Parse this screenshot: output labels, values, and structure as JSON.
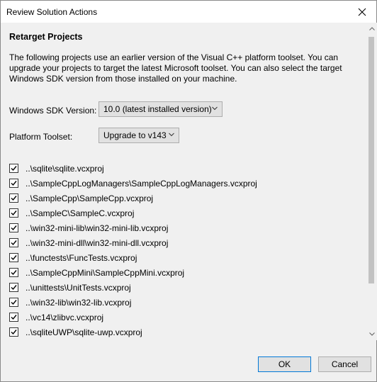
{
  "window": {
    "title": "Review Solution Actions"
  },
  "section": {
    "heading": "Retarget Projects",
    "description": "The following projects use an earlier version of the Visual C++ platform toolset.  You can upgrade your projects to target the latest Microsoft toolset.  You can also select the target Windows SDK version from those installed on your machine."
  },
  "sdk": {
    "label": "Windows SDK Version:",
    "value": "10.0 (latest installed version)"
  },
  "toolset": {
    "label": "Platform Toolset:",
    "value": "Upgrade to v143"
  },
  "projects": [
    {
      "label": "..\\sqlite\\sqlite.vcxproj",
      "checked": true
    },
    {
      "label": "..\\SampleCppLogManagers\\SampleCppLogManagers.vcxproj",
      "checked": true
    },
    {
      "label": "..\\SampleCpp\\SampleCpp.vcxproj",
      "checked": true
    },
    {
      "label": "..\\SampleC\\SampleC.vcxproj",
      "checked": true
    },
    {
      "label": "..\\win32-mini-lib\\win32-mini-lib.vcxproj",
      "checked": true
    },
    {
      "label": "..\\win32-mini-dll\\win32-mini-dll.vcxproj",
      "checked": true
    },
    {
      "label": "..\\functests\\FuncTests.vcxproj",
      "checked": true
    },
    {
      "label": "..\\SampleCppMini\\SampleCppMini.vcxproj",
      "checked": true
    },
    {
      "label": "..\\unittests\\UnitTests.vcxproj",
      "checked": true
    },
    {
      "label": "..\\win32-lib\\win32-lib.vcxproj",
      "checked": true
    },
    {
      "label": "..\\vc14\\zlibvc.vcxproj",
      "checked": true
    },
    {
      "label": "..\\sqliteUWP\\sqlite-uwp.vcxproj",
      "checked": true
    }
  ],
  "buttons": {
    "ok": "OK",
    "cancel": "Cancel"
  },
  "icons": {
    "close": "close-icon",
    "check": "checkmark-icon",
    "dropdown": "chevron-down-icon"
  }
}
